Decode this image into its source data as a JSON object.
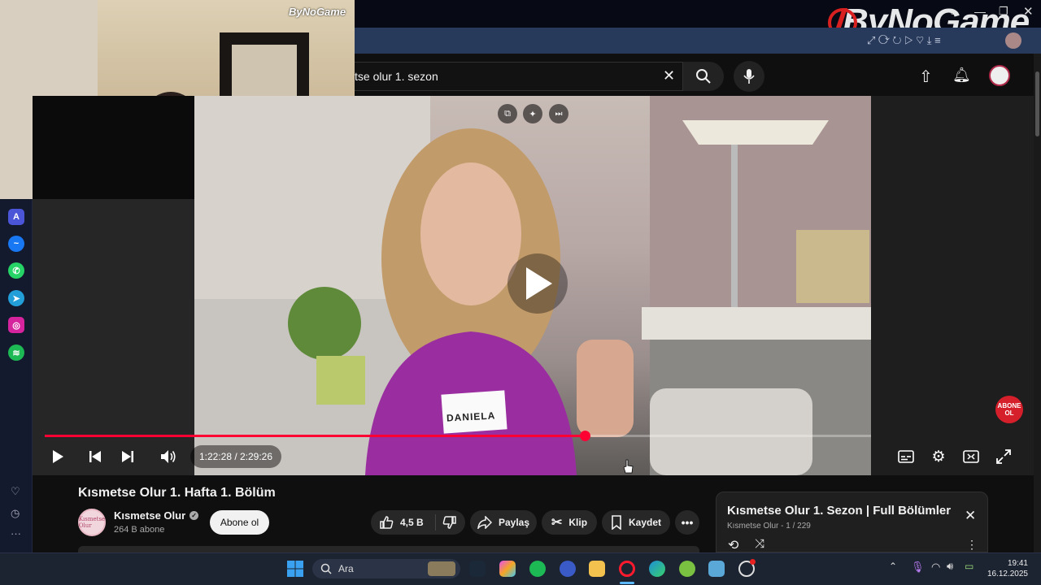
{
  "watermark": {
    "small": "ByNoGame",
    "big": "ByNoGame"
  },
  "search": {
    "query": "tse olur 1. sezon"
  },
  "video": {
    "name_tag": "DANIELA",
    "current_time": "1:22:28",
    "duration": "2:29:26",
    "time_display": "1:22:28 / 2:29:26",
    "progress_fraction": 0.654,
    "abone_badge": "ABONE\nOL"
  },
  "details": {
    "title": "Kısmetse Olur 1. Hafta 1. Bölüm",
    "channel_name": "Kısmetse Olur",
    "subscribers": "264 B abone",
    "subscribe_label": "Abone ol",
    "like_count": "4,5 B",
    "share_label": "Paylaş",
    "clip_label": "Klip",
    "save_label": "Kaydet"
  },
  "playlist": {
    "title": "Kısmetse Olur 1. Sezon | Full Bölümler",
    "channel": "Kısmetse Olur",
    "position": "1 / 229"
  },
  "taskbar": {
    "search_placeholder": "Ara",
    "time": "19:41",
    "date": "16.12.2025"
  },
  "colors": {
    "accent": "#ff0033",
    "taskbar": "#1c2331",
    "background": "#0f0f0f"
  }
}
